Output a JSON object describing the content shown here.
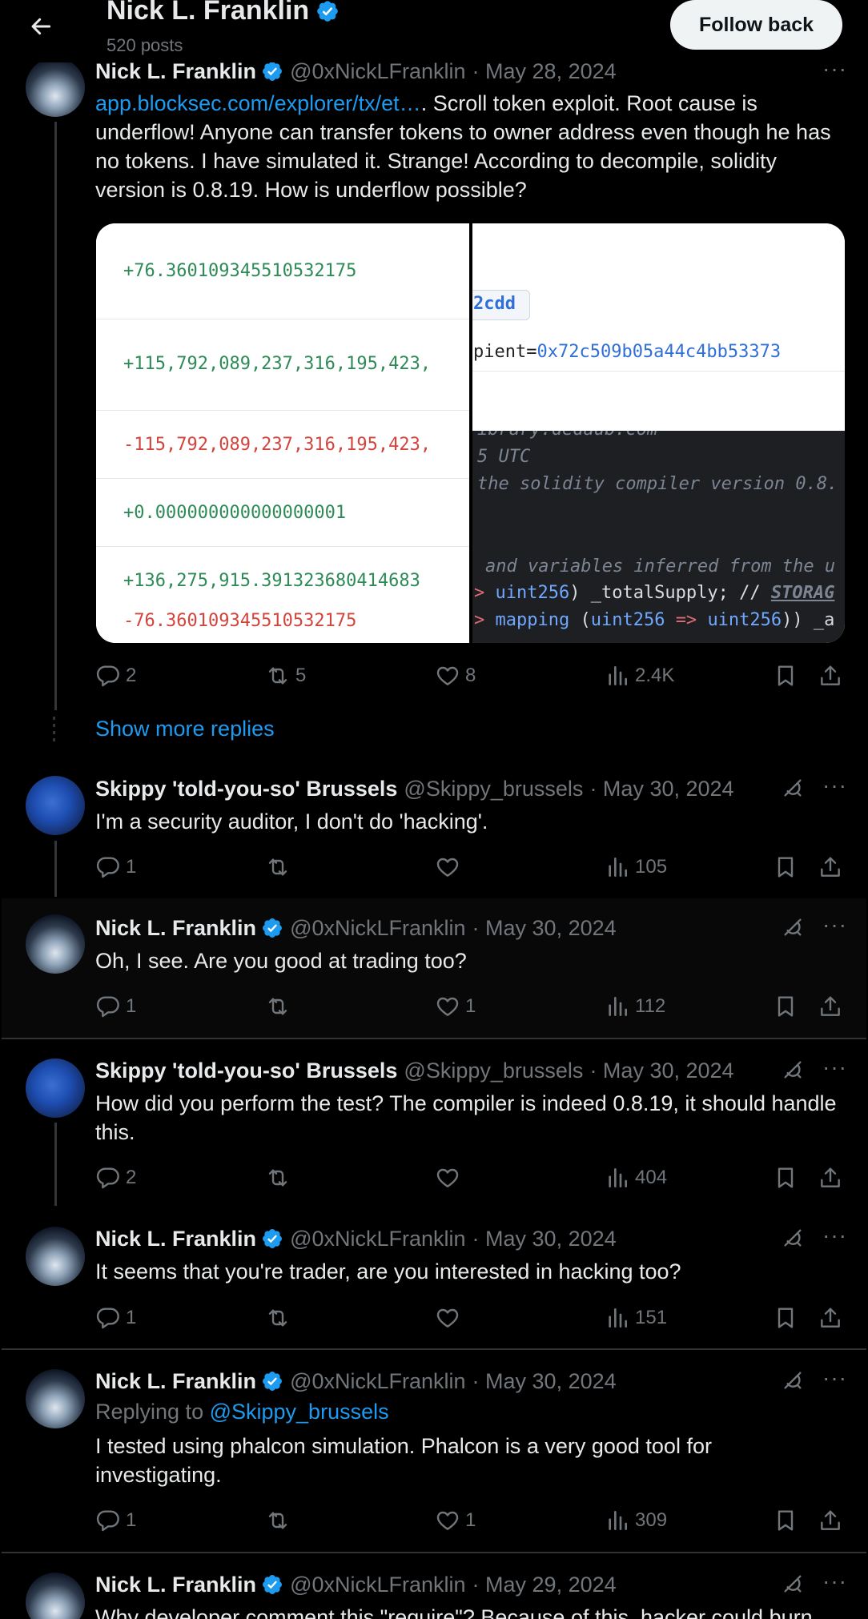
{
  "header": {
    "name": "Nick L. Franklin",
    "posts": "520 posts",
    "follow_label": "Follow back"
  },
  "colors": {
    "accent": "#1d9bf0",
    "verified": "#1d9bf0",
    "muted": "#71767b"
  },
  "main_tweet": {
    "name": "Nick L. Franklin",
    "handle": "@0xNickLFranklin",
    "date": "· May 28, 2024",
    "link": "app.blocksec.com/explorer/tx/et…",
    "text": ". Scroll token exploit. Root cause is underflow! Anyone can transfer tokens to owner address even though he has no tokens. I have simulated it. Strange! According to decompile, solidity version is 0.8.19. How is underflow possible?",
    "image": {
      "left_rows": [
        "+76.360109345510532175",
        "+115,792,089,237,316,195,423,",
        "-115,792,089,237,316,195,423,",
        "+0.000000000000000001",
        "+136,275,915.391323680414683",
        "-76.360109345510532175"
      ],
      "right_top": [
        "2cdd",
        "pient=",
        "0x72c509b05a44c4bb53373"
      ],
      "right_bottom": [
        "ibrary.dedaub.com",
        "5 UTC",
        "the solidity compiler version 0.8.",
        "and variables inferred from the u",
        ">",
        "uint256",
        ") _totalSupply; //",
        "STORAG",
        ">",
        "mapping",
        "(",
        "uint256",
        "=>",
        "uint256",
        ")) _a"
      ]
    },
    "replies": "2",
    "reposts": "5",
    "likes": "8",
    "views": "2.4K"
  },
  "show_more": "Show more replies",
  "tweets": [
    {
      "name": "Skippy 'told-you-so' Brussels",
      "handle": "@Skippy_brussels",
      "date": "· May 30, 2024",
      "text": "I'm a security auditor, I don't do 'hacking'.",
      "replies": "1",
      "reposts": "",
      "likes": "",
      "views": "105"
    },
    {
      "name": "Nick L. Franklin",
      "handle": "@0xNickLFranklin",
      "date": "· May 30, 2024",
      "text": "Oh, I see. Are you good at trading too?",
      "replies": "1",
      "reposts": "",
      "likes": "1",
      "views": "112"
    },
    {
      "name": "Skippy 'told-you-so' Brussels",
      "handle": "@Skippy_brussels",
      "date": "· May 30, 2024",
      "text": "How did you perform the test? The compiler is indeed 0.8.19, it should handle this.",
      "replies": "2",
      "reposts": "",
      "likes": "",
      "views": "404"
    },
    {
      "name": "Nick L. Franklin",
      "handle": "@0xNickLFranklin",
      "date": "· May 30, 2024",
      "text": "It seems that you're trader, are you interested in hacking too?",
      "replies": "1",
      "reposts": "",
      "likes": "",
      "views": "151"
    },
    {
      "name": "Nick L. Franklin",
      "handle": "@0xNickLFranklin",
      "date": "· May 30, 2024",
      "replying_prefix": "Replying to ",
      "replying_to": "@Skippy_brussels",
      "text": "I tested using phalcon simulation. Phalcon is a very good tool for investigating.",
      "replies": "1",
      "reposts": "",
      "likes": "1",
      "views": "309"
    },
    {
      "name": "Nick L. Franklin",
      "handle": "@0xNickLFranklin",
      "date": "· May 29, 2024",
      "text": "Why developer comment this \"require\"? Because of this, hacker could burn"
    }
  ]
}
